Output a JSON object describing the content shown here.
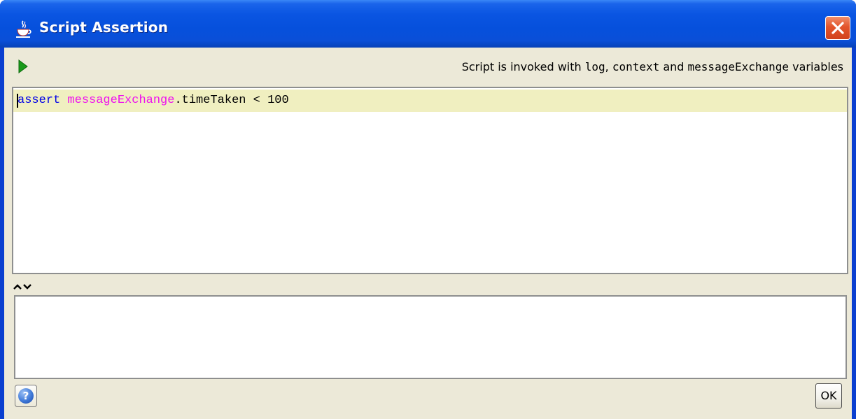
{
  "window": {
    "title": "Script Assertion",
    "app_icon": "java-cup-icon",
    "close_icon": "close-icon"
  },
  "toolbar": {
    "run_icon": "play-icon",
    "info_prefix": "Script is invoked with ",
    "info_var_log": "log",
    "info_sep": ", ",
    "info_var_context": "context",
    "info_and": " and ",
    "info_var_exchange": "messageExchange",
    "info_suffix": " variables"
  },
  "editor": {
    "line1": {
      "keyword": "assert",
      "space": " ",
      "variable": "messageExchange",
      "rest": ".timeTaken < 100"
    }
  },
  "splitter": {
    "up_icon": "chevron-up-icon",
    "down_icon": "chevron-down-icon"
  },
  "output": {
    "text": ""
  },
  "footer": {
    "help_icon": "help-icon",
    "help_symbol": "?",
    "ok_label": "OK"
  },
  "colors": {
    "titlebar": "#0a55e2",
    "client_bg": "#ece9d8",
    "current_line": "#f0efc0",
    "keyword": "#0000e6",
    "variable": "#ee11ee",
    "close_button": "#e3542b",
    "run_icon": "#1a9a1a"
  }
}
